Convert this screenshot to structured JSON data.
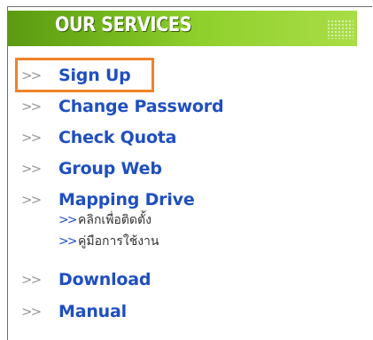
{
  "header": {
    "title": "OUR SERVICES"
  },
  "arrow_glyph": ">>",
  "menu": {
    "items": [
      {
        "label": "Sign Up"
      },
      {
        "label": "Change Password"
      },
      {
        "label": "Check Quota"
      },
      {
        "label": "Group Web"
      },
      {
        "label": "Mapping Drive"
      },
      {
        "label": "Download"
      },
      {
        "label": "Manual"
      }
    ],
    "sub_items": [
      {
        "label": "คลิกเพื่อติดตั้ง"
      },
      {
        "label": "คู่มือการใช้งาน"
      }
    ]
  },
  "colors": {
    "link": "#1f4fbf",
    "arrow": "#9a9a9a",
    "highlight": "#f0822a",
    "header_green": "#6fb21a"
  }
}
